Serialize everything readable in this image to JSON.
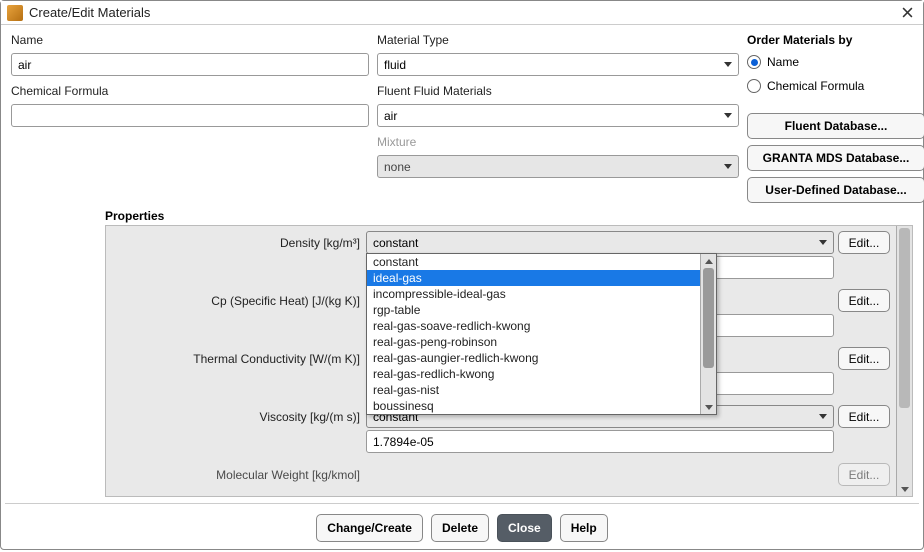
{
  "window": {
    "title": "Create/Edit Materials"
  },
  "fields": {
    "name_label": "Name",
    "name_value": "air",
    "formula_label": "Chemical Formula",
    "formula_value": "",
    "mtype_label": "Material Type",
    "mtype_value": "fluid",
    "ffm_label": "Fluent Fluid Materials",
    "ffm_value": "air",
    "mixture_label": "Mixture",
    "mixture_value": "none"
  },
  "order": {
    "heading": "Order Materials by",
    "opt_name": "Name",
    "opt_formula": "Chemical Formula",
    "selected": "name"
  },
  "db_buttons": {
    "fluent": "Fluent Database...",
    "granta": "GRANTA MDS Database...",
    "user": "User-Defined Database..."
  },
  "properties": {
    "heading": "Properties",
    "edit_label": "Edit...",
    "density": {
      "label": "Density [kg/m³]",
      "method": "constant"
    },
    "density_dropdown": {
      "items": [
        "constant",
        "ideal-gas",
        "incompressible-ideal-gas",
        "rgp-table",
        "real-gas-soave-redlich-kwong",
        "real-gas-peng-robinson",
        "real-gas-aungier-redlich-kwong",
        "real-gas-redlich-kwong",
        "real-gas-nist",
        "boussinesq"
      ],
      "highlighted_index": 1
    },
    "cp": {
      "label": "Cp (Specific Heat) [J/(kg K)]"
    },
    "kcond": {
      "label": "Thermal Conductivity [W/(m K)]"
    },
    "visc": {
      "label": "Viscosity [kg/(m s)]",
      "method": "constant",
      "value": "1.7894e-05"
    },
    "mw": {
      "label": "Molecular Weight [kg/kmol]"
    }
  },
  "footer": {
    "change_create": "Change/Create",
    "delete": "Delete",
    "close": "Close",
    "help": "Help"
  }
}
